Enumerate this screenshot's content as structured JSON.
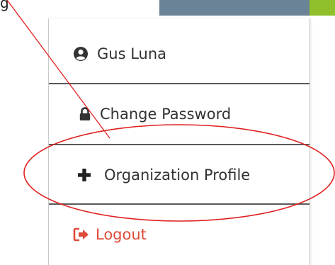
{
  "header": {
    "partial_text": "g"
  },
  "menu": {
    "items": [
      {
        "label": "Gus Luna",
        "icon": "user-circle-icon"
      },
      {
        "label": "Change Password",
        "icon": "lock-icon"
      },
      {
        "label": "Organization Profile",
        "icon": "plus-icon"
      },
      {
        "label": "Logout",
        "icon": "logout-icon"
      }
    ]
  },
  "colors": {
    "top_bar_slate": "#6b8396",
    "top_bar_green": "#8fbf2b",
    "annotation_red": "#e02020",
    "logout_red": "#e04a3a",
    "text": "#333333"
  }
}
